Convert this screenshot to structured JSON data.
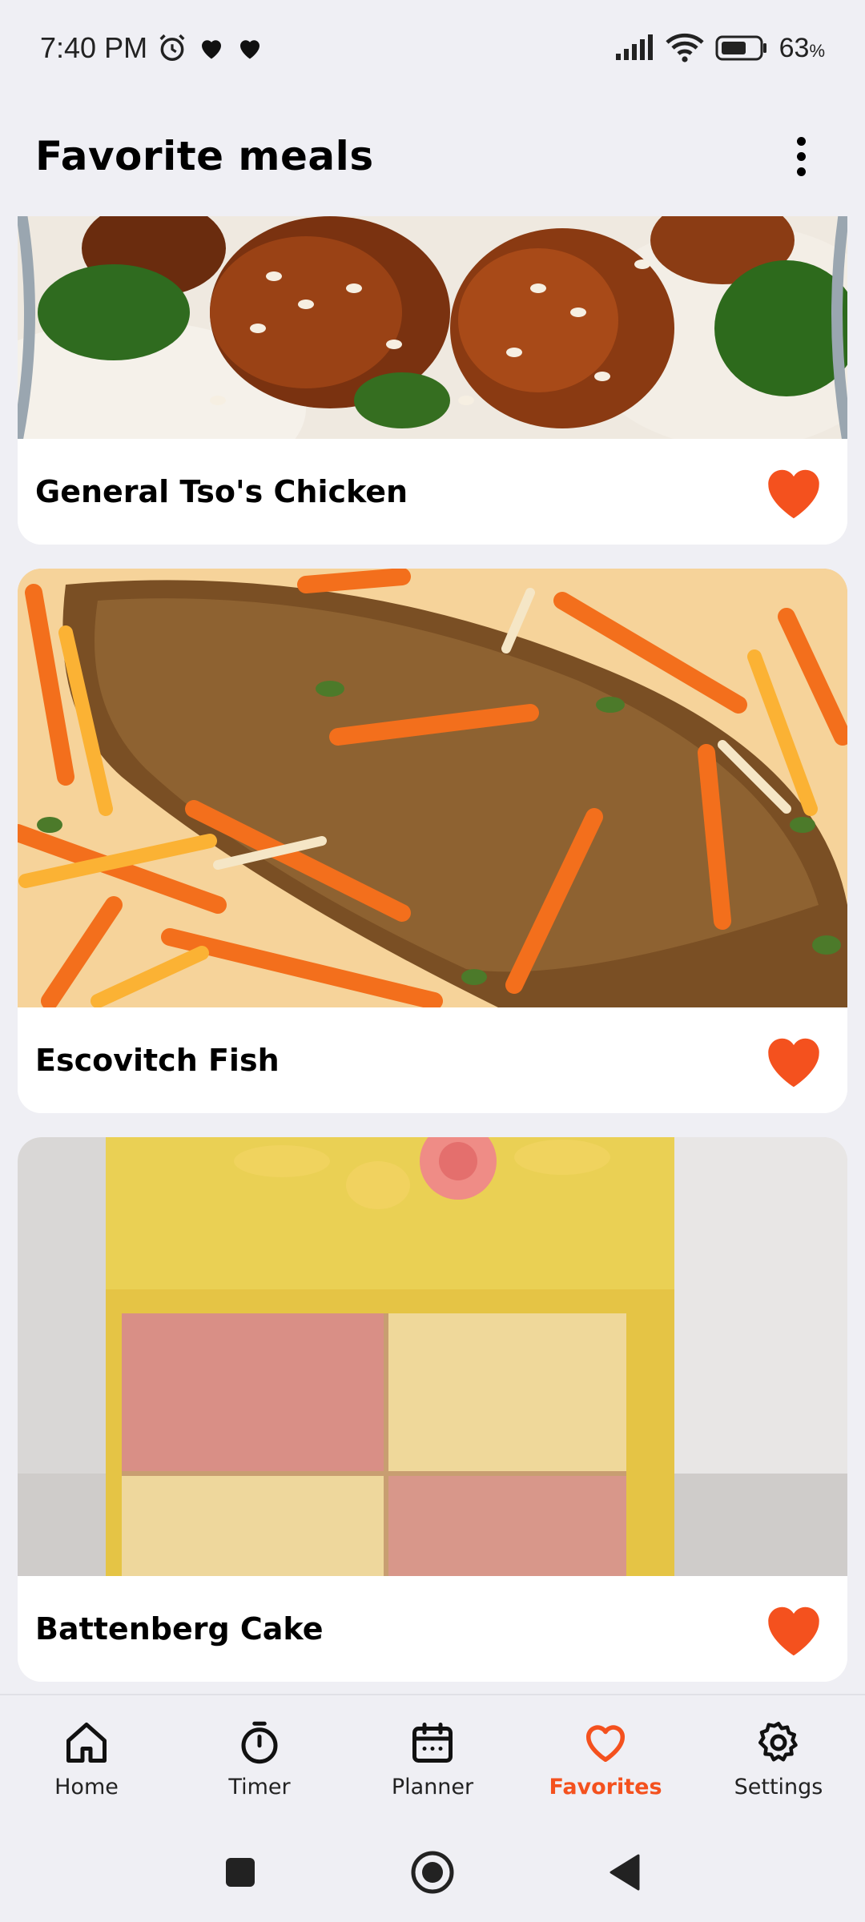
{
  "status_bar": {
    "time": "7:40 PM",
    "battery_percent": "63",
    "battery_unit": "%",
    "icons": [
      "alarm-icon",
      "heart-icon",
      "heart-icon",
      "signal-icon",
      "wifi-icon",
      "battery-icon"
    ]
  },
  "header": {
    "title": "Favorite meals",
    "menu_icon": "more-vertical-icon"
  },
  "meals": [
    {
      "name": "General Tso's Chicken",
      "favorited": true
    },
    {
      "name": "Escovitch Fish",
      "favorited": true
    },
    {
      "name": "Battenberg Cake",
      "favorited": true
    }
  ],
  "bottom_nav": {
    "items": [
      {
        "label": "Home",
        "icon": "home-icon",
        "active": false
      },
      {
        "label": "Timer",
        "icon": "timer-icon",
        "active": false
      },
      {
        "label": "Planner",
        "icon": "calendar-icon",
        "active": false
      },
      {
        "label": "Favorites",
        "icon": "heart-outline-icon",
        "active": true
      },
      {
        "label": "Settings",
        "icon": "gear-icon",
        "active": false
      }
    ]
  },
  "colors": {
    "accent": "#f4511e",
    "background": "#efeff4",
    "card": "#ffffff"
  }
}
